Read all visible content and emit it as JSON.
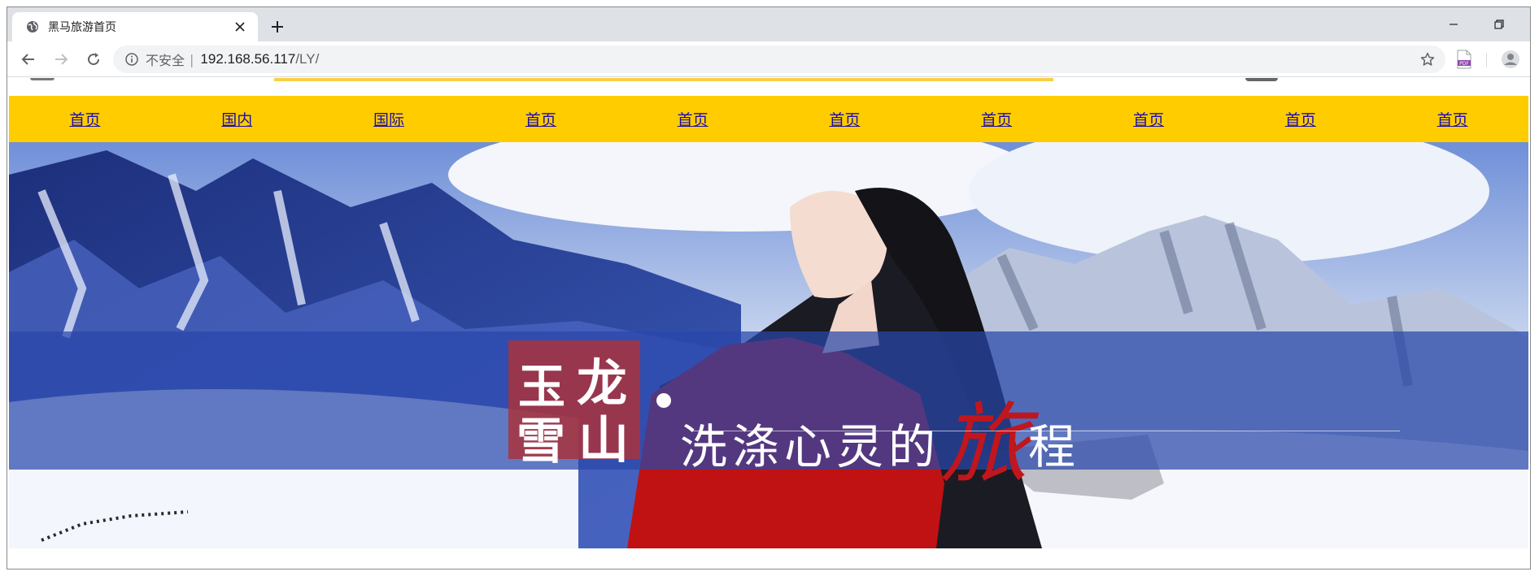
{
  "browser": {
    "tab_title": "黑马旅游首页",
    "security_label": "不安全",
    "security_separator": "|",
    "url_host": "192.168.56.117",
    "url_path": "/LY/",
    "pdf_extension_label": "PDF"
  },
  "nav": {
    "items": [
      "首页",
      "国内",
      "国际",
      "首页",
      "首页",
      "首页",
      "首页",
      "首页",
      "首页",
      "首页"
    ]
  },
  "banner": {
    "title_chars": [
      "玉",
      "龙",
      "雪",
      "山"
    ],
    "slogan_text": "洗涤心灵的",
    "slogan_highlight": "旅",
    "slogan_end": "程"
  },
  "colors": {
    "nav_bg": "#ffcc00",
    "link": "#1a0dab",
    "caption_band": "#2846aa",
    "title_box": "#aa323c",
    "highlight": "#c0161d"
  }
}
